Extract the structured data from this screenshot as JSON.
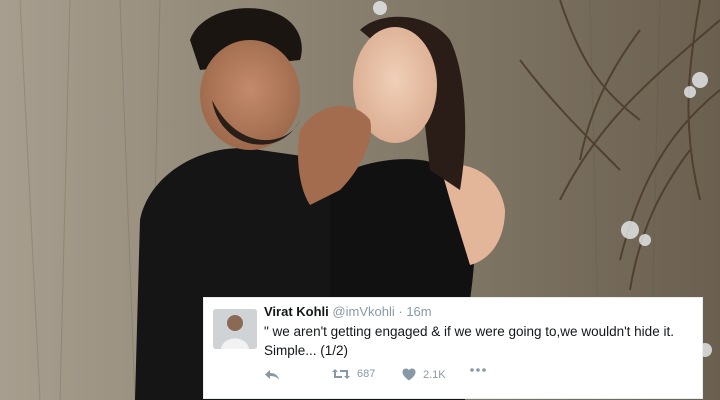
{
  "tweet": {
    "author_name": "Virat Kohli",
    "handle": "@imVkohli",
    "separator": "·",
    "time": "16m",
    "text_line1": "\" we aren't getting engaged & if we were going to,we wouldn't hide it.",
    "text_line2": "Simple... (1/2)",
    "retweets": "687",
    "likes": "2.1K"
  },
  "icons": {
    "reply": "reply-icon",
    "retweet": "retweet-icon",
    "like": "heart-icon",
    "more": "more-dots-icon"
  },
  "colors": {
    "card_background": "#ffffff",
    "muted_text": "#8899a6",
    "primary_text": "#14171a"
  }
}
